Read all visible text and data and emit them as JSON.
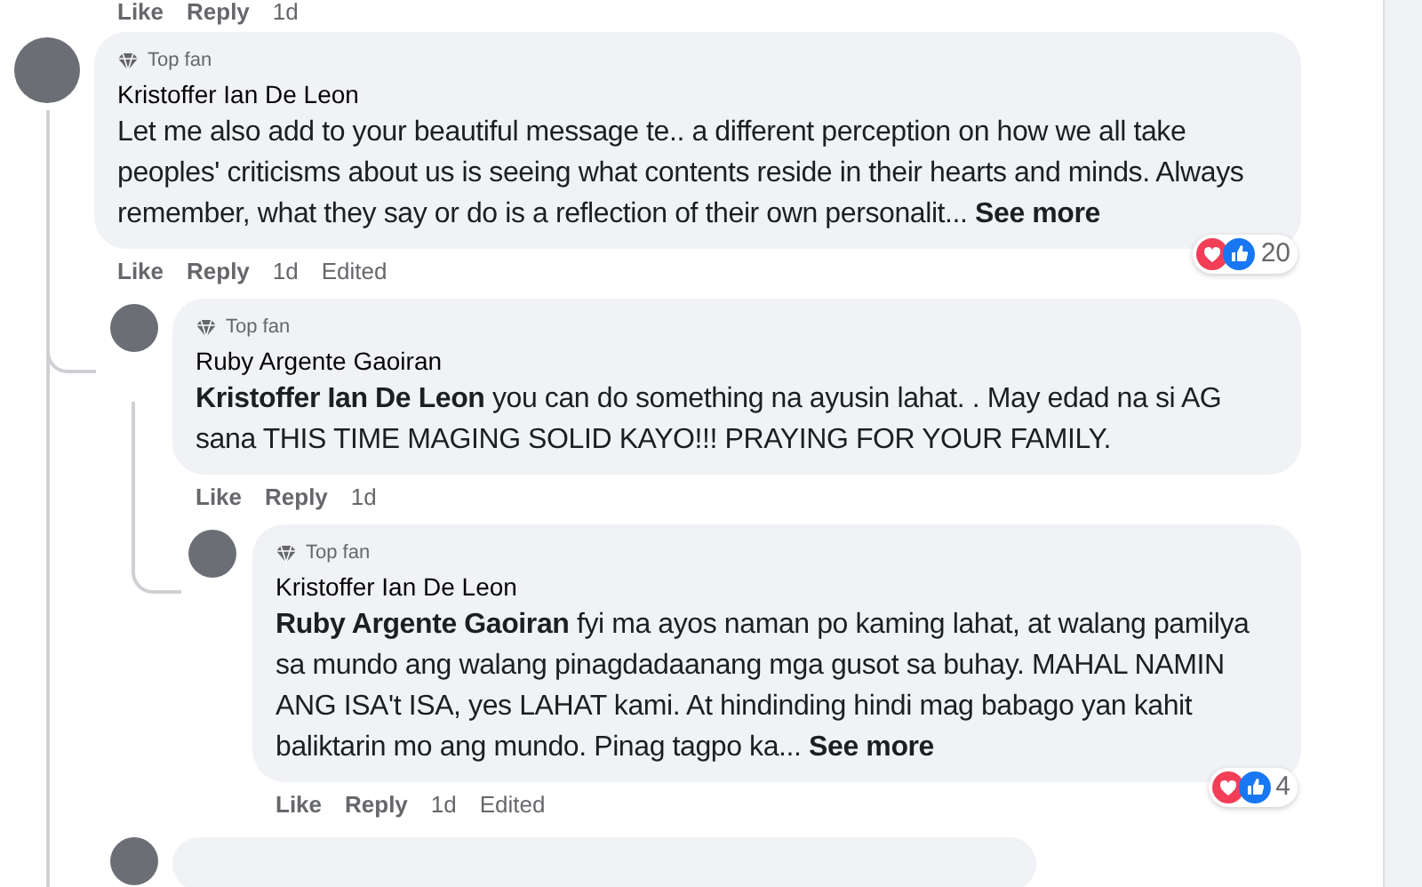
{
  "top_actions": {
    "like": "Like",
    "reply": "Reply",
    "time": "1d"
  },
  "comments": [
    {
      "badge": "Top fan",
      "author": "Kristoffer Ian De Leon",
      "body": "Let me also add to your beautiful message te.. a different perception on how we all take peoples' criticisms about us is seeing what contents reside in their hearts and minds. Always remember, what they say or do is a reflection of their own personalit...",
      "see_more": "See more",
      "like": "Like",
      "reply": "Reply",
      "time": "1d",
      "edited": "Edited",
      "reactions": "20",
      "replies": [
        {
          "badge": "Top fan",
          "author": "Ruby Argente Gaoiran",
          "body": "**Kristoffer Ian De Leon** you can do something na ayusin lahat. . May edad na si AG sana THIS TIME MAGING SOLID KAYO!!! PRAYING FOR YOUR FAMILY.",
          "like": "Like",
          "reply": "Reply",
          "time": "1d",
          "replies": [
            {
              "badge": "Top fan",
              "author": "Kristoffer Ian De Leon",
              "body": "**Ruby Argente Gaoiran** fyi ma ayos naman po kaming lahat, at walang pamilya sa mundo ang walang pinagdadaanang mga gusot sa buhay. MAHAL NAMIN ANG ISA't ISA, yes LAHAT kami. At hindinding hindi mag babago yan kahit baliktarin mo ang mundo. Pinag tagpo ka...",
              "see_more": "See more",
              "like": "Like",
              "reply": "Reply",
              "time": "1d",
              "edited": "Edited",
              "reactions": "4"
            }
          ]
        }
      ]
    }
  ]
}
